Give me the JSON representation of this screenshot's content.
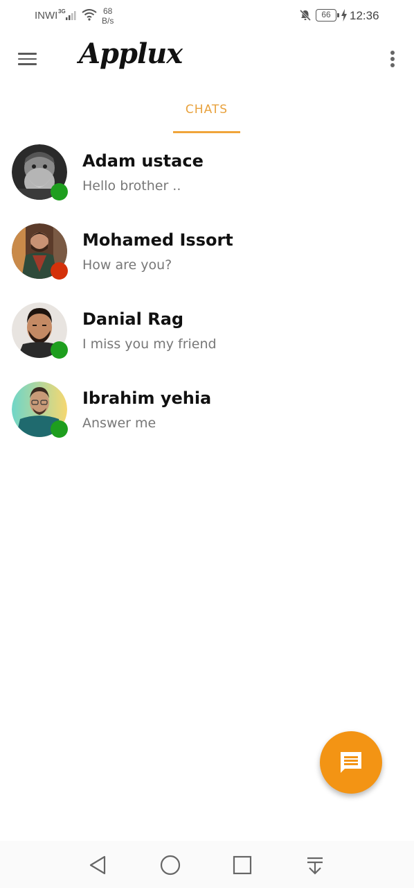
{
  "status_bar": {
    "carrier": "INWI",
    "network": "3G",
    "speed_value": "68",
    "speed_unit": "B/s",
    "battery": "66",
    "time": "12:36"
  },
  "app_bar": {
    "title": "Applux"
  },
  "tabs": [
    {
      "label": "CHATS",
      "active": true
    }
  ],
  "chats": [
    {
      "name": "Adam ustace",
      "message": "Hello brother ..",
      "status": "online"
    },
    {
      "name": "Mohamed Issort",
      "message": "How are you?",
      "status": "busy"
    },
    {
      "name": "Danial Rag",
      "message": "I miss you my friend",
      "status": "online"
    },
    {
      "name": "Ibrahim yehia",
      "message": "Answer me",
      "status": "online"
    }
  ],
  "colors": {
    "accent": "#f39414",
    "tab_text": "#e8a13c",
    "online": "#1e9e1e",
    "busy": "#d4310a"
  },
  "icons": {
    "menu": "menu-icon",
    "more": "more-vert-icon",
    "fab": "chat-bubble-icon",
    "nav_back": "back-triangle-icon",
    "nav_home": "home-circle-icon",
    "nav_recents": "recents-square-icon",
    "nav_notifications": "notification-pull-icon"
  }
}
